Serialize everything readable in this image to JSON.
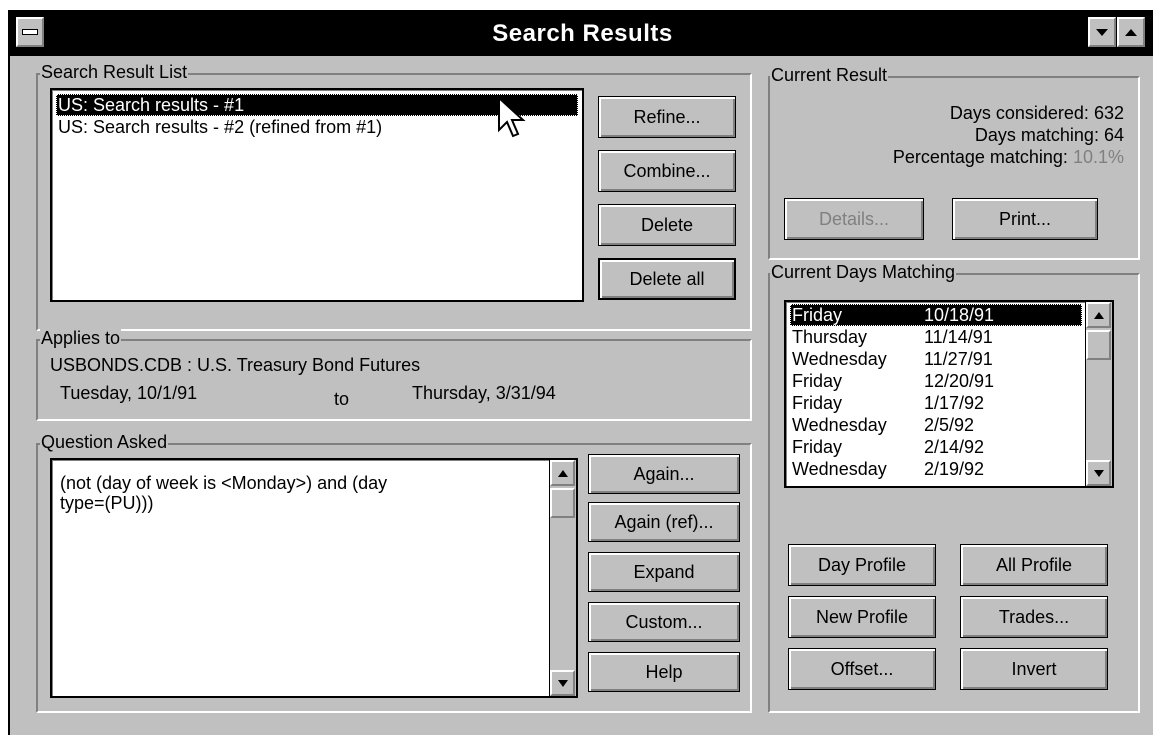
{
  "window": {
    "title": "Search Results"
  },
  "search_result_list": {
    "legend": "Search Result List",
    "items": [
      {
        "label": "US: Search results - #1",
        "selected": true
      },
      {
        "label": "US: Search results - #2 (refined from #1)",
        "selected": false
      }
    ],
    "buttons": {
      "refine": "Refine...",
      "combine": "Combine...",
      "delete": "Delete",
      "delete_all": "Delete all"
    }
  },
  "applies_to": {
    "legend": "Applies to",
    "database": "USBONDS.CDB : U.S. Treasury Bond Futures",
    "from": "Tuesday, 10/1/91",
    "to_label": "to",
    "to": "Thursday, 3/31/94"
  },
  "question_asked": {
    "legend": "Question Asked",
    "text_line1": "(not (day of week is <Monday>) and (day",
    "text_line2": "type=(PU)))",
    "buttons": {
      "again": "Again...",
      "again_ref": "Again (ref)...",
      "expand": "Expand",
      "custom": "Custom...",
      "help": "Help"
    }
  },
  "current_result": {
    "legend": "Current Result",
    "days_considered_label": "Days considered:",
    "days_considered": "632",
    "days_matching_label": "Days matching:",
    "days_matching": "64",
    "percentage_label": "Percentage matching:",
    "percentage": "10.1%",
    "buttons": {
      "details": "Details...",
      "print": "Print..."
    }
  },
  "current_days_matching": {
    "legend": "Current Days Matching",
    "rows": [
      {
        "day": "Friday",
        "date": "10/18/91",
        "selected": true
      },
      {
        "day": "Thursday",
        "date": "11/14/91",
        "selected": false
      },
      {
        "day": "Wednesday",
        "date": "11/27/91",
        "selected": false
      },
      {
        "day": "Friday",
        "date": "12/20/91",
        "selected": false
      },
      {
        "day": "Friday",
        "date": "1/17/92",
        "selected": false
      },
      {
        "day": "Wednesday",
        "date": "2/5/92",
        "selected": false
      },
      {
        "day": "Friday",
        "date": "2/14/92",
        "selected": false
      },
      {
        "day": "Wednesday",
        "date": "2/19/92",
        "selected": false
      }
    ],
    "buttons": {
      "day_profile": "Day Profile",
      "all_profile": "All Profile",
      "new_profile": "New Profile",
      "trades": "Trades...",
      "offset": "Offset...",
      "invert": "Invert"
    }
  },
  "colors": {
    "face": "#c0c0c0",
    "title_bar": "#000000",
    "selection": "#000000",
    "disabled_text": "#808080"
  }
}
